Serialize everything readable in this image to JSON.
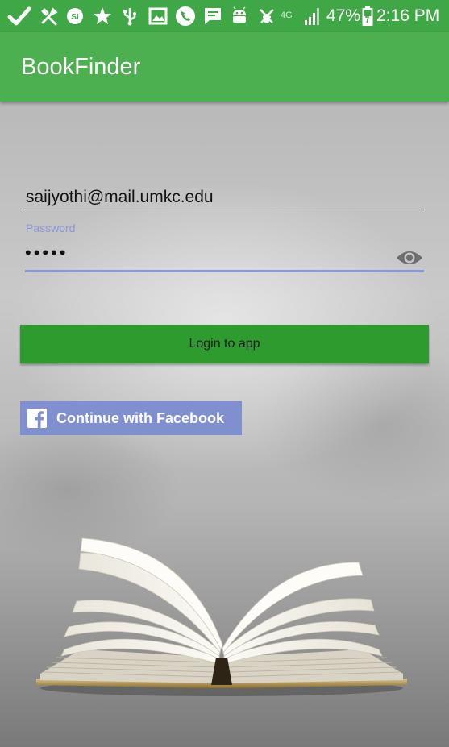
{
  "status_bar": {
    "network": "4G",
    "battery": "47%",
    "time": "2:16 PM"
  },
  "app_bar": {
    "title": "BookFinder"
  },
  "login_form": {
    "email_value": "saijyothi@mail.umkc.edu",
    "password_label": "Password",
    "password_masked": "•••••"
  },
  "buttons": {
    "login_label": "Login to app",
    "facebook_label": "Continue with Facebook"
  },
  "colors": {
    "status_bar": "#3fa745",
    "app_bar": "#4caf50",
    "login_button": "#2e9b2f",
    "facebook_button": "#7f8fd0",
    "password_accent": "#8b96e0"
  },
  "icons": [
    "check-icon",
    "tools-icon",
    "si-icon",
    "star-icon",
    "usb-icon",
    "image-icon",
    "phone-icon",
    "message-icon",
    "android-icon",
    "bug-icon",
    "signal-icon",
    "battery-icon",
    "eye-icon",
    "facebook-icon"
  ]
}
